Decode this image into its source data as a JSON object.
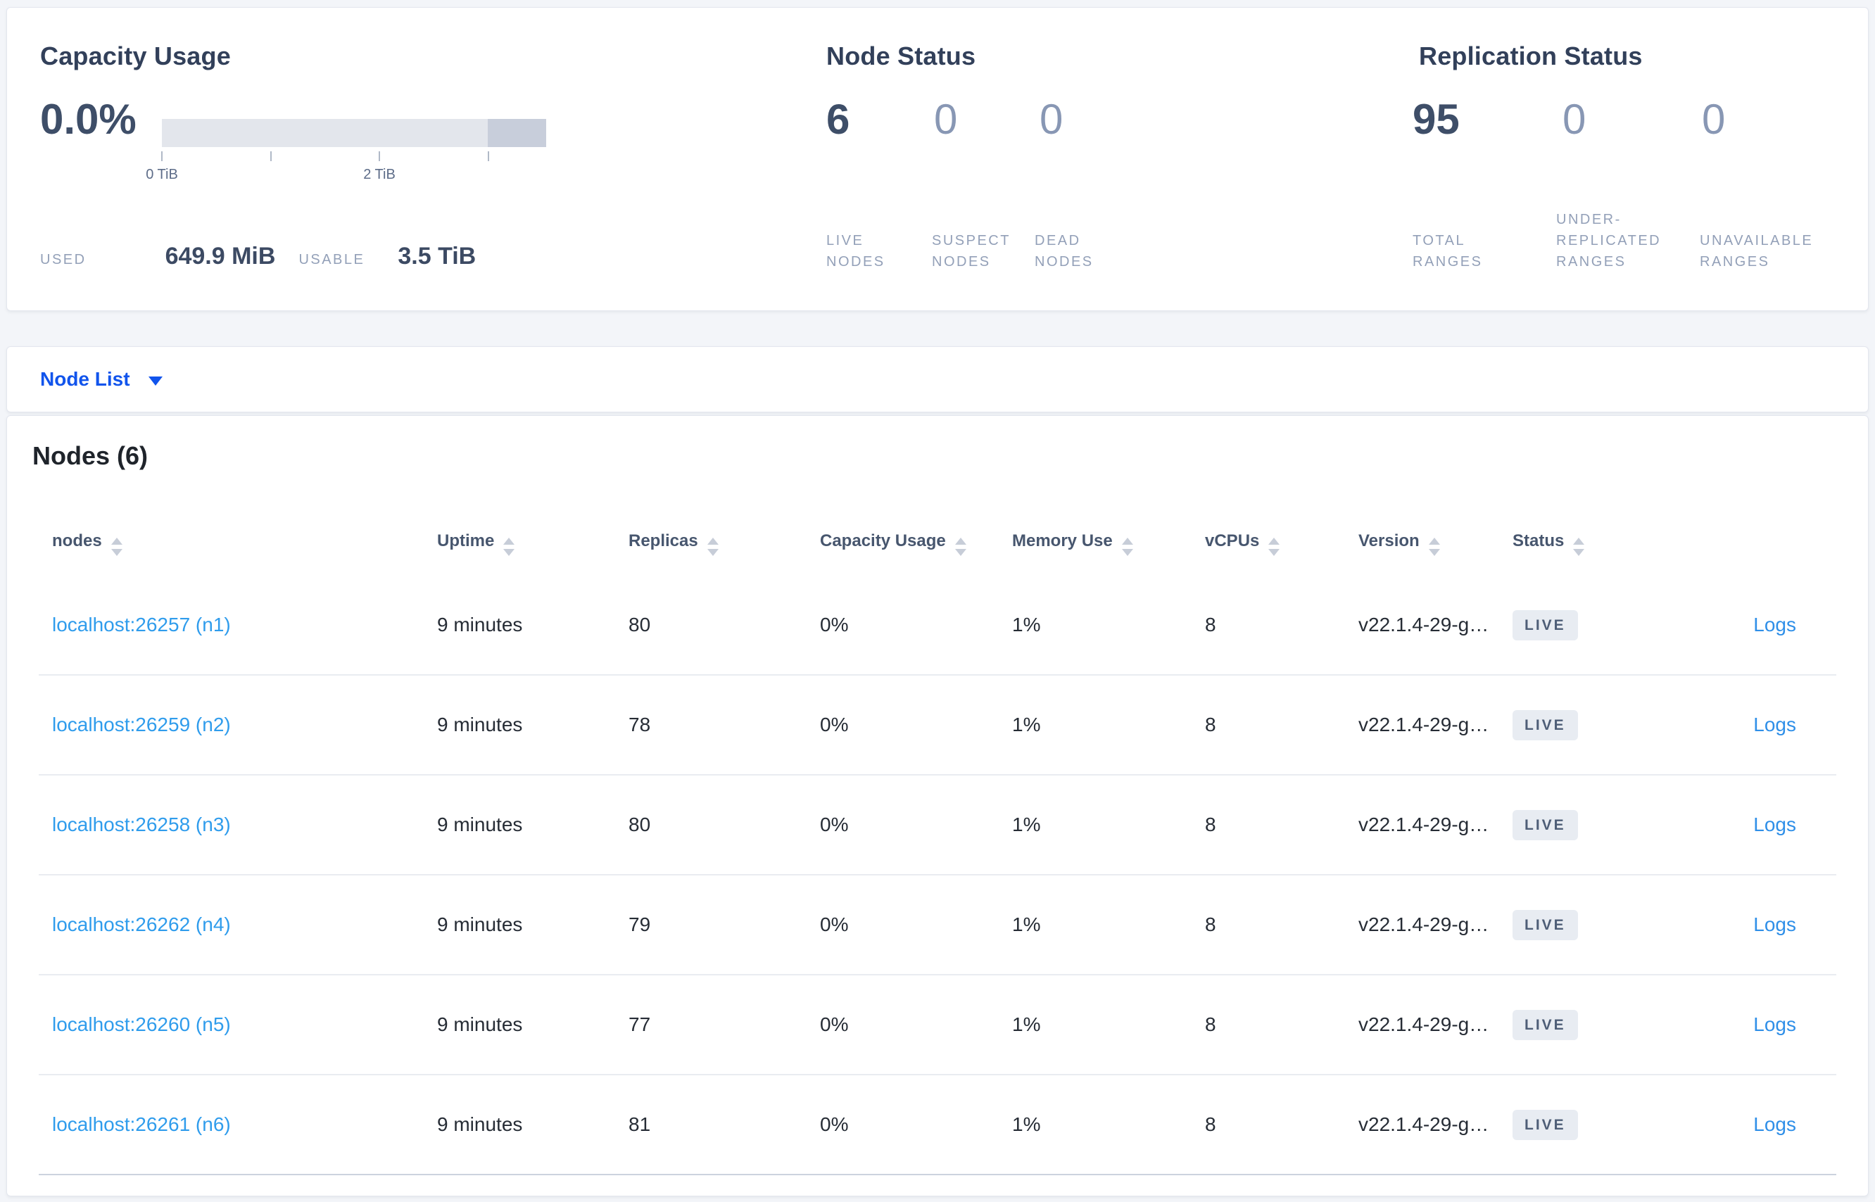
{
  "capacity": {
    "title": "Capacity Usage",
    "percent": "0.0%",
    "bar": {
      "light_color": "#e3e6ec",
      "dark_color": "#c8cedb",
      "dark_segment_pct": 15.2,
      "tick_fractions": [
        0,
        28.3,
        56.5,
        84.8
      ],
      "tick_labels": [
        {
          "text": "0 TiB",
          "pct": 0
        },
        {
          "text": "2 TiB",
          "pct": 56.5
        }
      ]
    },
    "used_label": "USED",
    "used_value": "649.9 MiB",
    "usable_label": "USABLE",
    "usable_value": "3.5 TiB"
  },
  "node_status": {
    "title": "Node Status",
    "stats": [
      {
        "value": "6",
        "lines": [
          "LIVE",
          "NODES"
        ]
      },
      {
        "value": "0",
        "lines": [
          "SUSPECT",
          "NODES"
        ]
      },
      {
        "value": "0",
        "lines": [
          "DEAD",
          "NODES"
        ]
      }
    ]
  },
  "replication": {
    "title": "Replication Status",
    "stats": [
      {
        "value": "95",
        "lines": [
          "TOTAL",
          "RANGES"
        ]
      },
      {
        "value": "0",
        "lines": [
          "UNDER-",
          "REPLICATED",
          "RANGES"
        ]
      },
      {
        "value": "0",
        "lines": [
          "UNAVAILABLE",
          "RANGES"
        ]
      }
    ]
  },
  "node_list": {
    "label": "Node List"
  },
  "nodes_section": {
    "heading": "Nodes (6)"
  },
  "table": {
    "headers": {
      "nodes": "nodes",
      "uptime": "Uptime",
      "replicas": "Replicas",
      "capacity": "Capacity Usage",
      "memory": "Memory Use",
      "vcpus": "vCPUs",
      "version": "Version",
      "status": "Status"
    },
    "rows": [
      {
        "node": "localhost:26257 (n1)",
        "uptime": "9 minutes",
        "replicas": "80",
        "capacity": "0%",
        "memory": "1%",
        "vcpus": "8",
        "version": "v22.1.4-29-g…",
        "status": "LIVE",
        "logs": "Logs"
      },
      {
        "node": "localhost:26259 (n2)",
        "uptime": "9 minutes",
        "replicas": "78",
        "capacity": "0%",
        "memory": "1%",
        "vcpus": "8",
        "version": "v22.1.4-29-g…",
        "status": "LIVE",
        "logs": "Logs"
      },
      {
        "node": "localhost:26258 (n3)",
        "uptime": "9 minutes",
        "replicas": "80",
        "capacity": "0%",
        "memory": "1%",
        "vcpus": "8",
        "version": "v22.1.4-29-g…",
        "status": "LIVE",
        "logs": "Logs"
      },
      {
        "node": "localhost:26262 (n4)",
        "uptime": "9 minutes",
        "replicas": "79",
        "capacity": "0%",
        "memory": "1%",
        "vcpus": "8",
        "version": "v22.1.4-29-g…",
        "status": "LIVE",
        "logs": "Logs"
      },
      {
        "node": "localhost:26260 (n5)",
        "uptime": "9 minutes",
        "replicas": "77",
        "capacity": "0%",
        "memory": "1%",
        "vcpus": "8",
        "version": "v22.1.4-29-g…",
        "status": "LIVE",
        "logs": "Logs"
      },
      {
        "node": "localhost:26261 (n6)",
        "uptime": "9 minutes",
        "replicas": "81",
        "capacity": "0%",
        "memory": "1%",
        "vcpus": "8",
        "version": "v22.1.4-29-g…",
        "status": "LIVE",
        "logs": "Logs"
      }
    ]
  },
  "colors": {
    "accent_blue": "#1154ec",
    "link_blue": "#2f9cec",
    "stat_dark": "#3e4e68",
    "stat_muted": "#8897b4",
    "badge_bg": "#e8ecf2"
  }
}
